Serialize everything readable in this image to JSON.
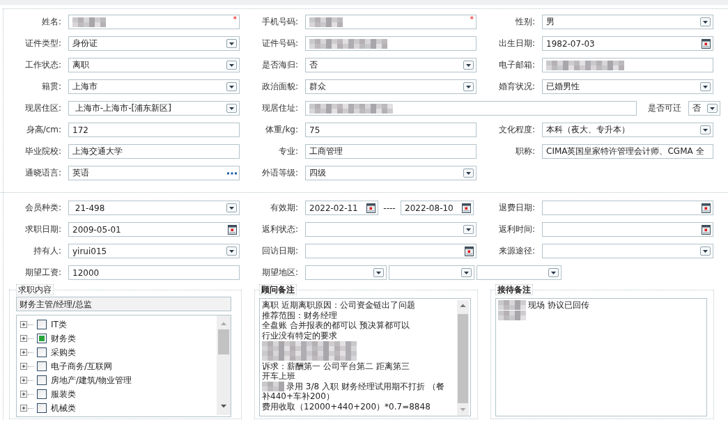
{
  "personal": {
    "rows": [
      {
        "cells": [
          {
            "label": "姓名:",
            "kind": "text",
            "redacted": true,
            "required_mark": "*"
          },
          {
            "label": "手机号码:",
            "kind": "text",
            "redacted": true,
            "required_mark": "*"
          },
          {
            "label": "性别:",
            "kind": "select",
            "value": "男"
          }
        ]
      },
      {
        "cells": [
          {
            "label": "证件类型:",
            "kind": "select",
            "value": "身份证"
          },
          {
            "label": "证件号码:",
            "kind": "text",
            "redacted": true
          },
          {
            "label": "出生日期:",
            "kind": "date",
            "value": "1982-07-03"
          }
        ]
      },
      {
        "cells": [
          {
            "label": "工作状态:",
            "kind": "select",
            "value": "离职"
          },
          {
            "label": "是否海归:",
            "kind": "select",
            "value": "否"
          },
          {
            "label": "电子邮箱:",
            "kind": "text",
            "redacted": true
          }
        ]
      },
      {
        "cells": [
          {
            "label": "籍贯:",
            "kind": "select",
            "value": "上海市"
          },
          {
            "label": "政治面貌:",
            "kind": "select",
            "value": "群众"
          },
          {
            "label": "婚育状况:",
            "kind": "select",
            "value": "已婚男性"
          }
        ]
      },
      {
        "cells": [
          {
            "label": "现居住区:",
            "kind": "select",
            "value": " 上海市-上海市-[浦东新区]"
          },
          {
            "label": "现居住址:",
            "kind": "address",
            "redacted": true
          },
          {
            "label": "是否可迁",
            "kind": "mini-select",
            "value": "否"
          }
        ]
      },
      {
        "cells": [
          {
            "label": "身高/cm:",
            "kind": "text",
            "value": "172"
          },
          {
            "label": "体重/kg:",
            "kind": "text",
            "value": "75"
          },
          {
            "label": "文化程度:",
            "kind": "select",
            "value": "本科（夜大、专升本）"
          }
        ]
      },
      {
        "cells": [
          {
            "label": "毕业院校:",
            "kind": "text",
            "value": "上海交通大学"
          },
          {
            "label": "专业:",
            "kind": "text",
            "value": "工商管理"
          },
          {
            "label": "职称:",
            "kind": "text",
            "value": "CIMA英国皇家特许管理会计师、CGMA 全"
          }
        ]
      },
      {
        "cells": [
          {
            "label": "通晓语言:",
            "kind": "lookup",
            "value": "英语"
          },
          {
            "label": "外语等级:",
            "kind": "select",
            "value": "四级"
          }
        ]
      }
    ]
  },
  "membership": {
    "rows": [
      {
        "cells": [
          {
            "label": "会员种类:",
            "kind": "select",
            "value": " 21-498"
          },
          {
            "label": "有效期:",
            "kind": "date-range",
            "from": "2022-02-11",
            "separator": "----",
            "to": "2022-08-10"
          },
          {
            "label": "退费日期:",
            "kind": "date"
          }
        ]
      },
      {
        "cells": [
          {
            "label": "求职日期:",
            "kind": "date",
            "value": "2009-05-01"
          },
          {
            "label": "返利状态:",
            "kind": "select"
          },
          {
            "label": "返利时间:",
            "kind": "date"
          }
        ]
      },
      {
        "cells": [
          {
            "label": "持有人:",
            "kind": "select",
            "value": "yirui015"
          },
          {
            "label": "回访日期:",
            "kind": "date"
          },
          {
            "label": "来源途径:",
            "kind": "select"
          }
        ]
      },
      {
        "cells": [
          {
            "label": "期望工资:",
            "kind": "text",
            "value": "12000"
          },
          {
            "label": "期望地区:",
            "kind": "multi-select",
            "selects": [
              {
                "kind": "select"
              },
              {
                "kind": "select"
              },
              {
                "kind": "select"
              }
            ]
          }
        ]
      }
    ]
  },
  "job_panel": {
    "legend": "求职内容",
    "selection": "财务主管/经理/总监",
    "tree": [
      {
        "label": "IT类",
        "checked": false,
        "expanded": false
      },
      {
        "label": "财务类",
        "checked": true,
        "expanded": false
      },
      {
        "label": "采购类",
        "checked": false,
        "expanded": false
      },
      {
        "label": "电子商务/互联网",
        "checked": false,
        "expanded": false
      },
      {
        "label": "房地产/建筑/物业管理",
        "checked": false,
        "expanded": false
      },
      {
        "label": "服装类",
        "checked": false,
        "expanded": false
      },
      {
        "label": "机械类",
        "checked": false,
        "expanded": false
      }
    ]
  },
  "advisor_notes": {
    "legend": "顾问备注",
    "scrollbar": true,
    "lines": [
      {
        "kind": "text",
        "text": "离职 近期离职原因：公司资金链出了问题"
      },
      {
        "kind": "text",
        "text": "推荐范围：财务经理"
      },
      {
        "kind": "text",
        "text": "全盘账 合并报表的都可以  预决算都可以"
      },
      {
        "kind": "text",
        "text": "行业没有特定的要求"
      },
      {
        "kind": "blurred"
      },
      {
        "kind": "blurred"
      },
      {
        "kind": "text",
        "text": "诉求：薪酬第一  公司平台第二 距离第三"
      },
      {
        "kind": "text",
        "text": "开车上班"
      },
      {
        "kind": "blurred-prefix",
        "text": "录用 3/8 入职 财务经理试用期不打折  （餐"
      },
      {
        "kind": "text",
        "text": "补440+车补200）"
      },
      {
        "kind": "text",
        "text": "费用收取（12000+440+200）*0.7=8848"
      }
    ]
  },
  "reception_notes": {
    "legend": "接待备注",
    "scrollbar": false,
    "lines": [
      {
        "kind": "blurred-prefix",
        "text": "现场 协议已回传"
      },
      {
        "kind": "blurred"
      }
    ]
  }
}
